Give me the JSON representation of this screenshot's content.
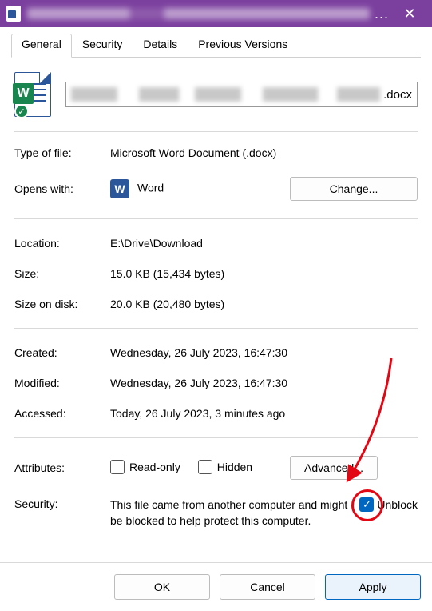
{
  "titlebar": {
    "title_obscured": true,
    "close_tooltip": "Close"
  },
  "tabs": [
    {
      "label": "General",
      "active": true
    },
    {
      "label": "Security",
      "active": false
    },
    {
      "label": "Details",
      "active": false
    },
    {
      "label": "Previous Versions",
      "active": false
    }
  ],
  "file": {
    "name_obscured": true,
    "extension": ".docx",
    "icon": "word-document"
  },
  "rows": {
    "type_label": "Type of file:",
    "type_value": "Microsoft Word Document (.docx)",
    "opens_label": "Opens with:",
    "opens_value": "Word",
    "change_button": "Change...",
    "location_label": "Location:",
    "location_value": "E:\\Drive\\Download",
    "size_label": "Size:",
    "size_value": "15.0 KB (15,434 bytes)",
    "disk_label": "Size on disk:",
    "disk_value": "20.0 KB (20,480 bytes)",
    "created_label": "Created:",
    "created_value": "Wednesday, 26 July 2023, 16:47:30",
    "modified_label": "Modified:",
    "modified_value": "Wednesday, 26 July 2023, 16:47:30",
    "accessed_label": "Accessed:",
    "accessed_value": "Today, 26 July 2023, 3 minutes ago",
    "attributes_label": "Attributes:",
    "readonly_label": "Read-only",
    "readonly_checked": false,
    "hidden_label": "Hidden",
    "hidden_checked": false,
    "advanced_button": "Advanced...",
    "security_label": "Security:",
    "security_text": "This file came from another computer and might be blocked to help protect this computer.",
    "unblock_label": "Unblock",
    "unblock_checked": true
  },
  "footer": {
    "ok": "OK",
    "cancel": "Cancel",
    "apply": "Apply"
  },
  "annotation": {
    "arrow_color": "#e30613"
  }
}
